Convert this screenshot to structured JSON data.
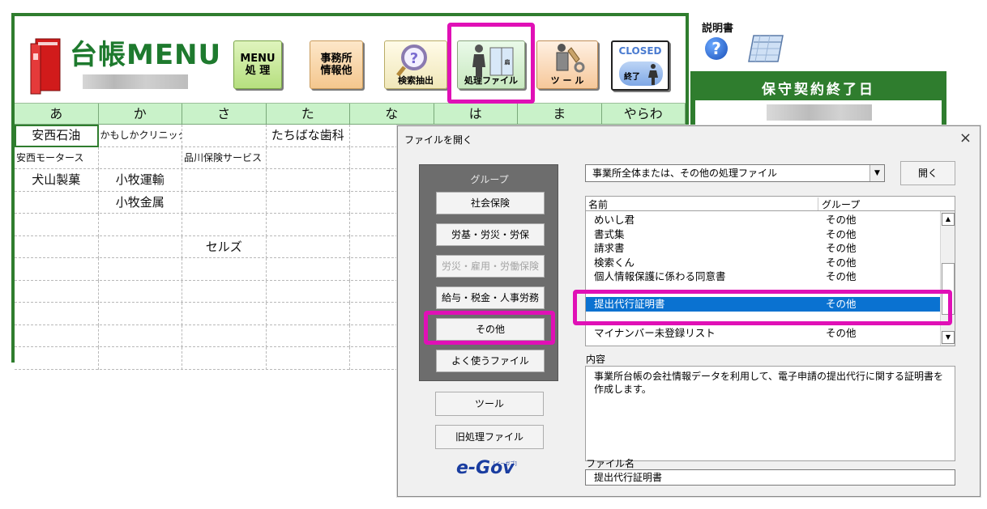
{
  "main": {
    "title": "台帳MENU",
    "toolbar": {
      "menu_label_1": "MENU",
      "menu_label_2": "処 理",
      "office_label_1": "事務所",
      "office_label_2": "情報他",
      "search_label": "検索抽出",
      "process_label": "処理ファイル",
      "tool_label": "ツ ー ル",
      "closed_label": "CLOSED",
      "closed_sub": "終了"
    },
    "kana": [
      "あ",
      "か",
      "さ",
      "た",
      "な",
      "は",
      "ま",
      "やらわ"
    ],
    "rows": [
      [
        "安西石油",
        "かもしかクリニック",
        "",
        "たちばな歯科",
        "",
        "",
        "",
        ""
      ],
      [
        "安西モータース",
        "",
        "品川保険サービス",
        "",
        "",
        "",
        "",
        ""
      ],
      [
        "犬山製菓",
        "小牧運輸",
        "",
        "",
        "",
        "",
        "",
        ""
      ],
      [
        "",
        "小牧金属",
        "",
        "",
        "",
        "",
        "",
        ""
      ],
      [
        "",
        "",
        "",
        "",
        "",
        "",
        "",
        ""
      ],
      [
        "",
        "",
        "セルズ",
        "",
        "",
        "",
        "",
        ""
      ],
      [
        "",
        "",
        "",
        "",
        "",
        "",
        "",
        ""
      ],
      [
        "",
        "",
        "",
        "",
        "",
        "",
        "",
        ""
      ],
      [
        "",
        "",
        "",
        "",
        "",
        "",
        "",
        ""
      ],
      [
        "",
        "",
        "",
        "",
        "",
        "",
        "",
        ""
      ],
      [
        "",
        "",
        "",
        "",
        "",
        "",
        "",
        ""
      ]
    ]
  },
  "side": {
    "manual_label": "説明書",
    "help_icon_glyph": "?",
    "panel_title": "保守契約終了日"
  },
  "dialog": {
    "title": "ファイルを開く",
    "close_glyph": "×",
    "group_label": "グループ",
    "group_buttons": [
      "社会保険",
      "労基・労災・労保",
      "労災・雇用・労働保険",
      "給与・税金・人事労務",
      "その他",
      "よく使うファイル"
    ],
    "tool_button": "ツール",
    "old_files_button": "旧処理ファイル",
    "egov_label": "e-Gov",
    "egov_tag": "[イーガブ]",
    "combo_value": "事業所全体または、その他の処理ファイル",
    "open_button": "開く",
    "list_headers": {
      "name": "名前",
      "group": "グループ"
    },
    "list_rows": [
      {
        "name": "めいし君",
        "group": "その他"
      },
      {
        "name": "書式集",
        "group": "その他"
      },
      {
        "name": "請求書",
        "group": "その他"
      },
      {
        "name": "検索くん",
        "group": "その他"
      },
      {
        "name": "個人情報保護に係わる同意書",
        "group": "その他"
      },
      {
        "name": "提出代行証明書",
        "group": "その他",
        "selected": true
      },
      {
        "name": "マイナンバー未登録リスト",
        "group": "その他"
      }
    ],
    "content_label": "内容",
    "content_text": "事業所台帳の会社情報データを利用して、電子申請の提出代行に関する証明書を作成します。",
    "filename_label": "ファイル名",
    "filename_value": "提出代行証明書"
  },
  "colors": {
    "frame_green": "#2f7d2e",
    "kana_bg": "#c9f2c9",
    "highlight": "#e010b6",
    "selection": "#0a72d1"
  }
}
